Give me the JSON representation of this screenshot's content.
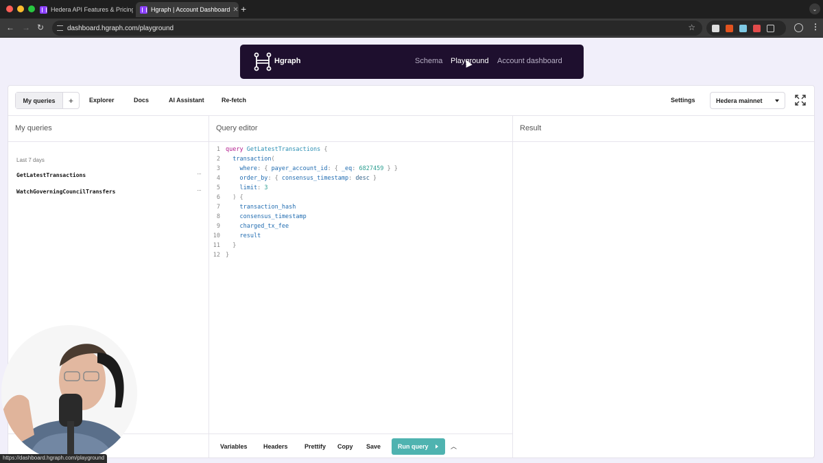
{
  "browser": {
    "tabs": [
      {
        "title": "Hedera API Features & Pricing"
      },
      {
        "title": "Hgraph | Account Dashboard",
        "active": true
      }
    ],
    "url": "dashboard.hgraph.com/playground",
    "status_url": "https://dashboard.hgraph.com/playground"
  },
  "header": {
    "brand": "Hgraph",
    "nav": [
      {
        "label": "Schema"
      },
      {
        "label": "Playground",
        "active": true
      },
      {
        "label": "Account dashboard"
      }
    ]
  },
  "toolbar": {
    "my_queries": "My queries",
    "add": "+",
    "explorer": "Explorer",
    "docs": "Docs",
    "ai_assistant": "AI Assistant",
    "refetch": "Re-fetch",
    "settings": "Settings",
    "network": "Hedera mainnet"
  },
  "sidebar": {
    "title": "My queries",
    "section": "Last 7 days",
    "queries": [
      {
        "name": "GetLatestTransactions"
      },
      {
        "name": "WatchGoverningCouncilTransfers"
      }
    ]
  },
  "editor": {
    "title": "Query editor",
    "line_numbers": [
      "1",
      "2",
      "3",
      "4",
      "5",
      "6",
      "7",
      "8",
      "9",
      "10",
      "11",
      "12"
    ]
  },
  "result": {
    "title": "Result"
  },
  "bottom": {
    "variables": "Variables",
    "headers": "Headers",
    "prettify": "Prettify",
    "copy": "Copy",
    "save": "Save",
    "run": "Run query"
  },
  "colors": {
    "accent": "#4fb3b0",
    "header_bg": "#1e0f2e",
    "keyword": "#b11a8c"
  }
}
